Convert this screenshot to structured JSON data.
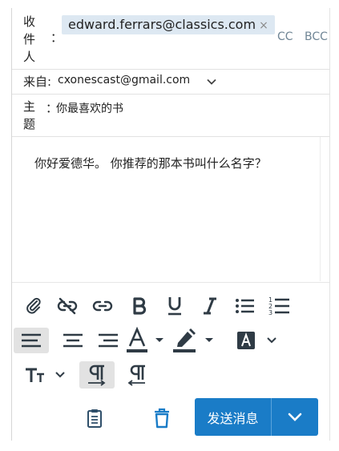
{
  "compose": {
    "to_label": "收件人",
    "to_colon": "：",
    "to_chip": "edward.ferrars@classics.com",
    "to_chip_remove": "×",
    "cc_label": "CC",
    "bcc_label": "BCC",
    "from_label": "来自:",
    "from_value": "cxonescast@gmail.com",
    "subject_label": "主题",
    "subject_colon": "：",
    "subject_value": "你最喜欢的书",
    "body_text": "你好爱德华。 你推荐的那本书叫什么名字？"
  },
  "toolbar": {
    "items": [
      {
        "icon": "paperclip-icon"
      },
      {
        "icon": "unlink-icon"
      },
      {
        "icon": "link-icon"
      },
      {
        "icon": "bold-icon"
      },
      {
        "icon": "underline-icon"
      },
      {
        "icon": "italic-icon"
      },
      {
        "icon": "bulleted-list-icon"
      },
      {
        "icon": "numbered-list-icon"
      },
      {
        "icon": "align-left-icon",
        "active": true
      },
      {
        "icon": "align-center-icon"
      },
      {
        "icon": "align-right-icon"
      },
      {
        "icon": "font-color-icon"
      },
      {
        "icon": "highlight-color-icon"
      },
      {
        "icon": "background-color-icon"
      },
      {
        "icon": "font-size-icon"
      },
      {
        "icon": "ltr-paragraph-icon",
        "active": true
      },
      {
        "icon": "rtl-paragraph-icon"
      }
    ]
  },
  "footer": {
    "send_label": "发送消息",
    "template_icon": "clipboard-icon",
    "delete_icon": "trash-icon"
  },
  "colors": {
    "accent": "#1a7cc7",
    "chip_bg": "#dde8f2",
    "cc_text": "#6f8595",
    "active_tool_bg": "#e2e2e2",
    "icon_dark": "#2f3b45"
  }
}
